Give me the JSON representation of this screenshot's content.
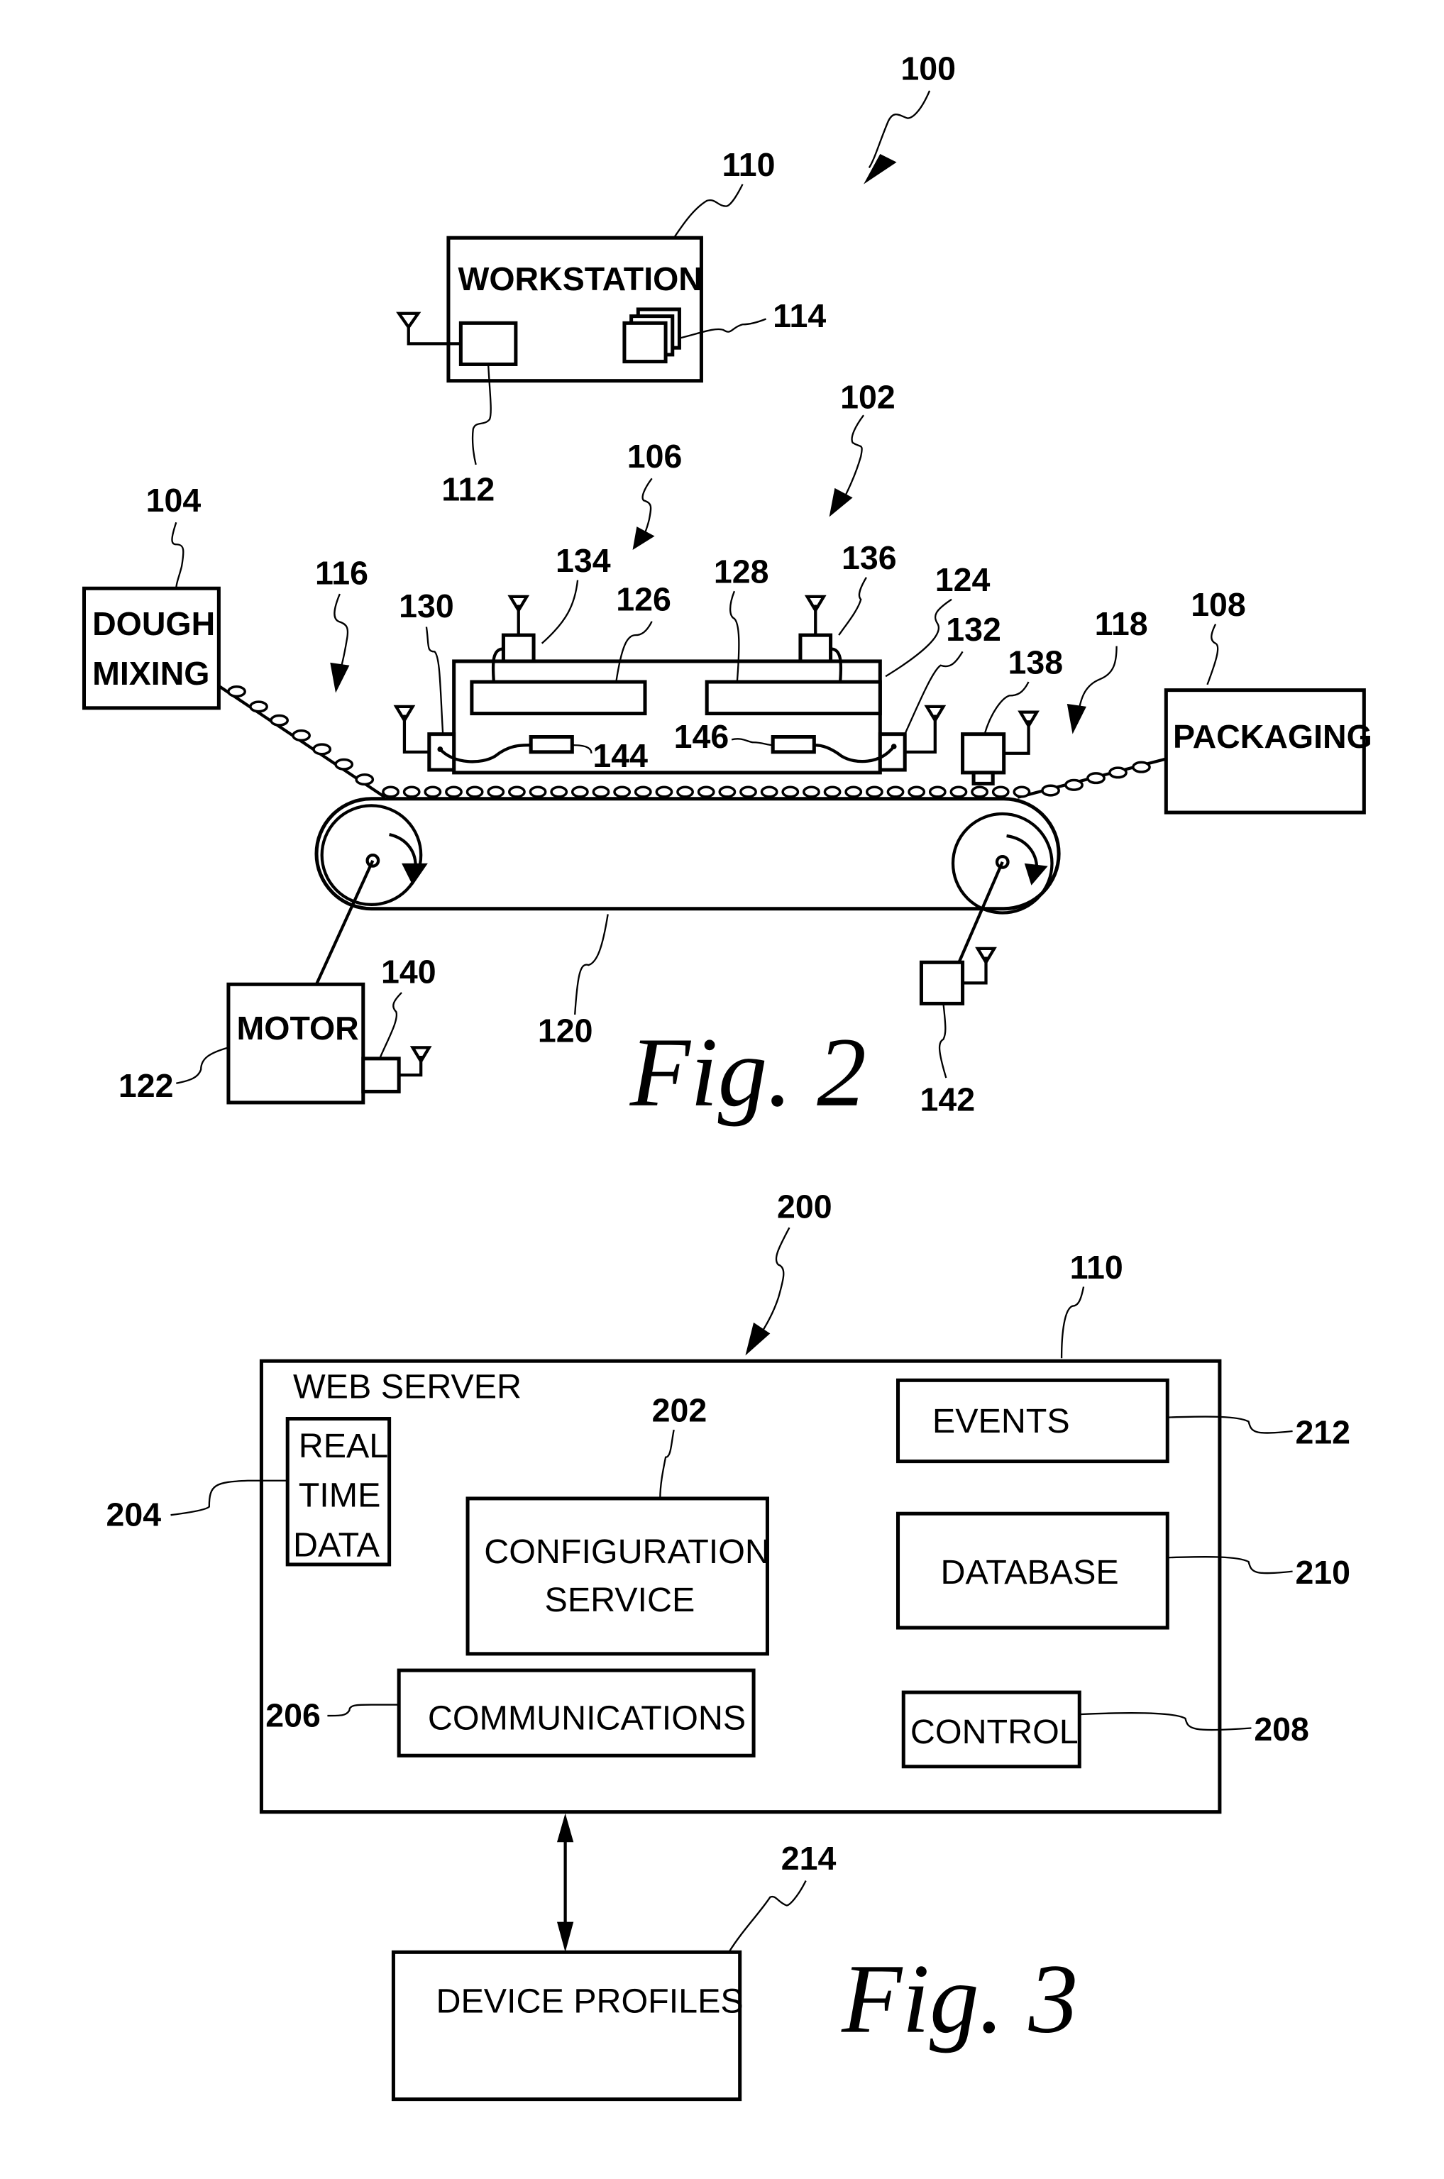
{
  "figure2": {
    "caption": "Fig. 2",
    "refs": {
      "system": "100",
      "line": "102",
      "dough_mixing": "104",
      "oven": "106",
      "packaging": "108",
      "workstation": "110",
      "transceiver": "112",
      "software": "114",
      "input_conveyor": "116",
      "output_conveyor": "118",
      "belt": "120",
      "motor": "122",
      "oven_body": "124",
      "heater_1": "126",
      "heater_2": "128",
      "sensor_left": "130",
      "sensor_right": "132",
      "controller_1": "134",
      "controller_2": "136",
      "camera": "138",
      "motor_sensor": "140",
      "roller_sensor": "142",
      "thermo_1": "144",
      "thermo_2": "146"
    },
    "labels": {
      "workstation": "WORKSTATION",
      "dough_line1": "DOUGH",
      "dough_line2": "MIXING",
      "packaging": "PACKAGING",
      "motor": "MOTOR"
    }
  },
  "figure3": {
    "caption": "Fig. 3",
    "refs": {
      "system": "200",
      "web_server": "110",
      "configuration_service": "202",
      "real_time_data": "204",
      "communications": "206",
      "control": "208",
      "database": "210",
      "events": "212",
      "device_profiles": "214"
    },
    "labels": {
      "web_server": "WEB SERVER",
      "real_time_line1": "REAL",
      "real_time_line2": "TIME",
      "real_time_line3": "DATA",
      "configuration_line1": "CONFIGURATION",
      "configuration_line2": "SERVICE",
      "communications": "COMMUNICATIONS",
      "events": "EVENTS",
      "database": "DATABASE",
      "control": "CONTROL",
      "device_profiles": "DEVICE PROFILES"
    }
  }
}
